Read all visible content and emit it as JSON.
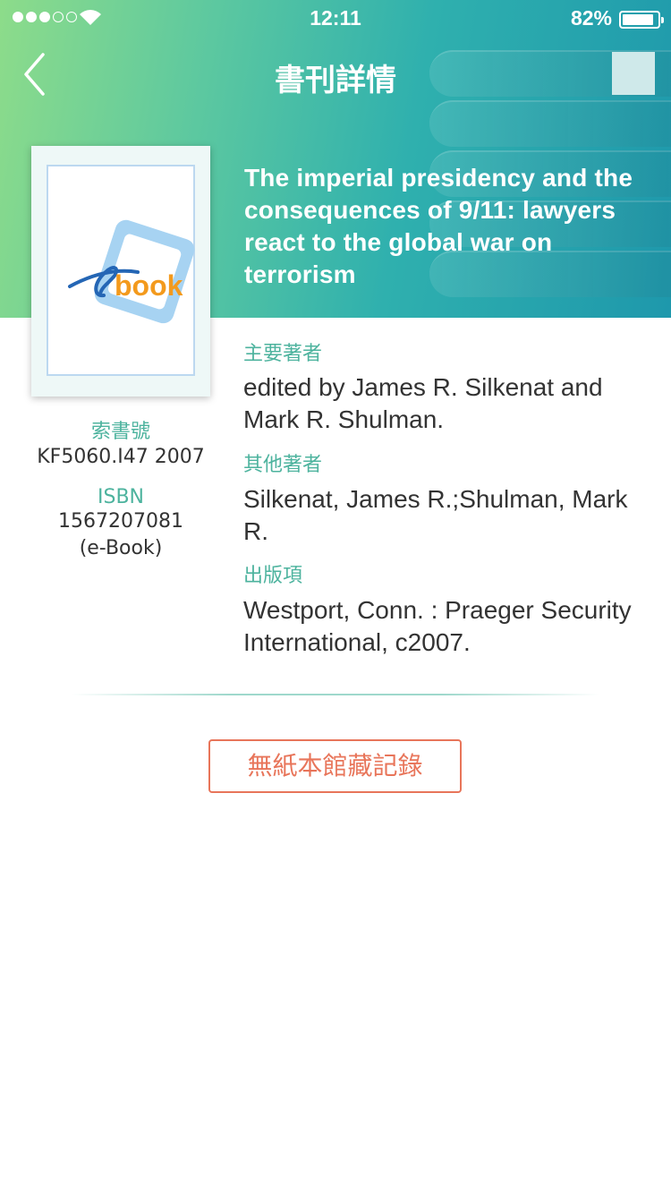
{
  "status_bar": {
    "time": "12:11",
    "battery_percent": "82%",
    "signal_bars_filled": 3,
    "signal_bars_total": 5
  },
  "nav": {
    "title": "書刊詳情",
    "back_icon": "chevron-left-icon"
  },
  "book": {
    "cover_logo_text": "book",
    "title": "The imperial presidency and the consequences of 9/11: lawyers react to the global war on terrorism",
    "call_number_label": "索書號",
    "call_number": "KF5060.I47 2007",
    "isbn_label": "ISBN",
    "isbn": "1567207081",
    "isbn_note": "(e-Book)",
    "main_author_label": "主要著者",
    "main_author": "edited by James R. Silkenat and Mark R. Shulman.",
    "other_authors_label": "其他著者",
    "other_authors": "Silkenat, James R.;Shulman, Mark R.",
    "publication_label": "出版項",
    "publication": "Westport, Conn. : Praeger Security International, c2007."
  },
  "actions": {
    "no_holding_label": "無紙本館藏記錄"
  },
  "colors": {
    "accent": "#4db39e",
    "button": "#e8755a",
    "header_start": "#8ddc8a",
    "header_end": "#1e98ac"
  }
}
